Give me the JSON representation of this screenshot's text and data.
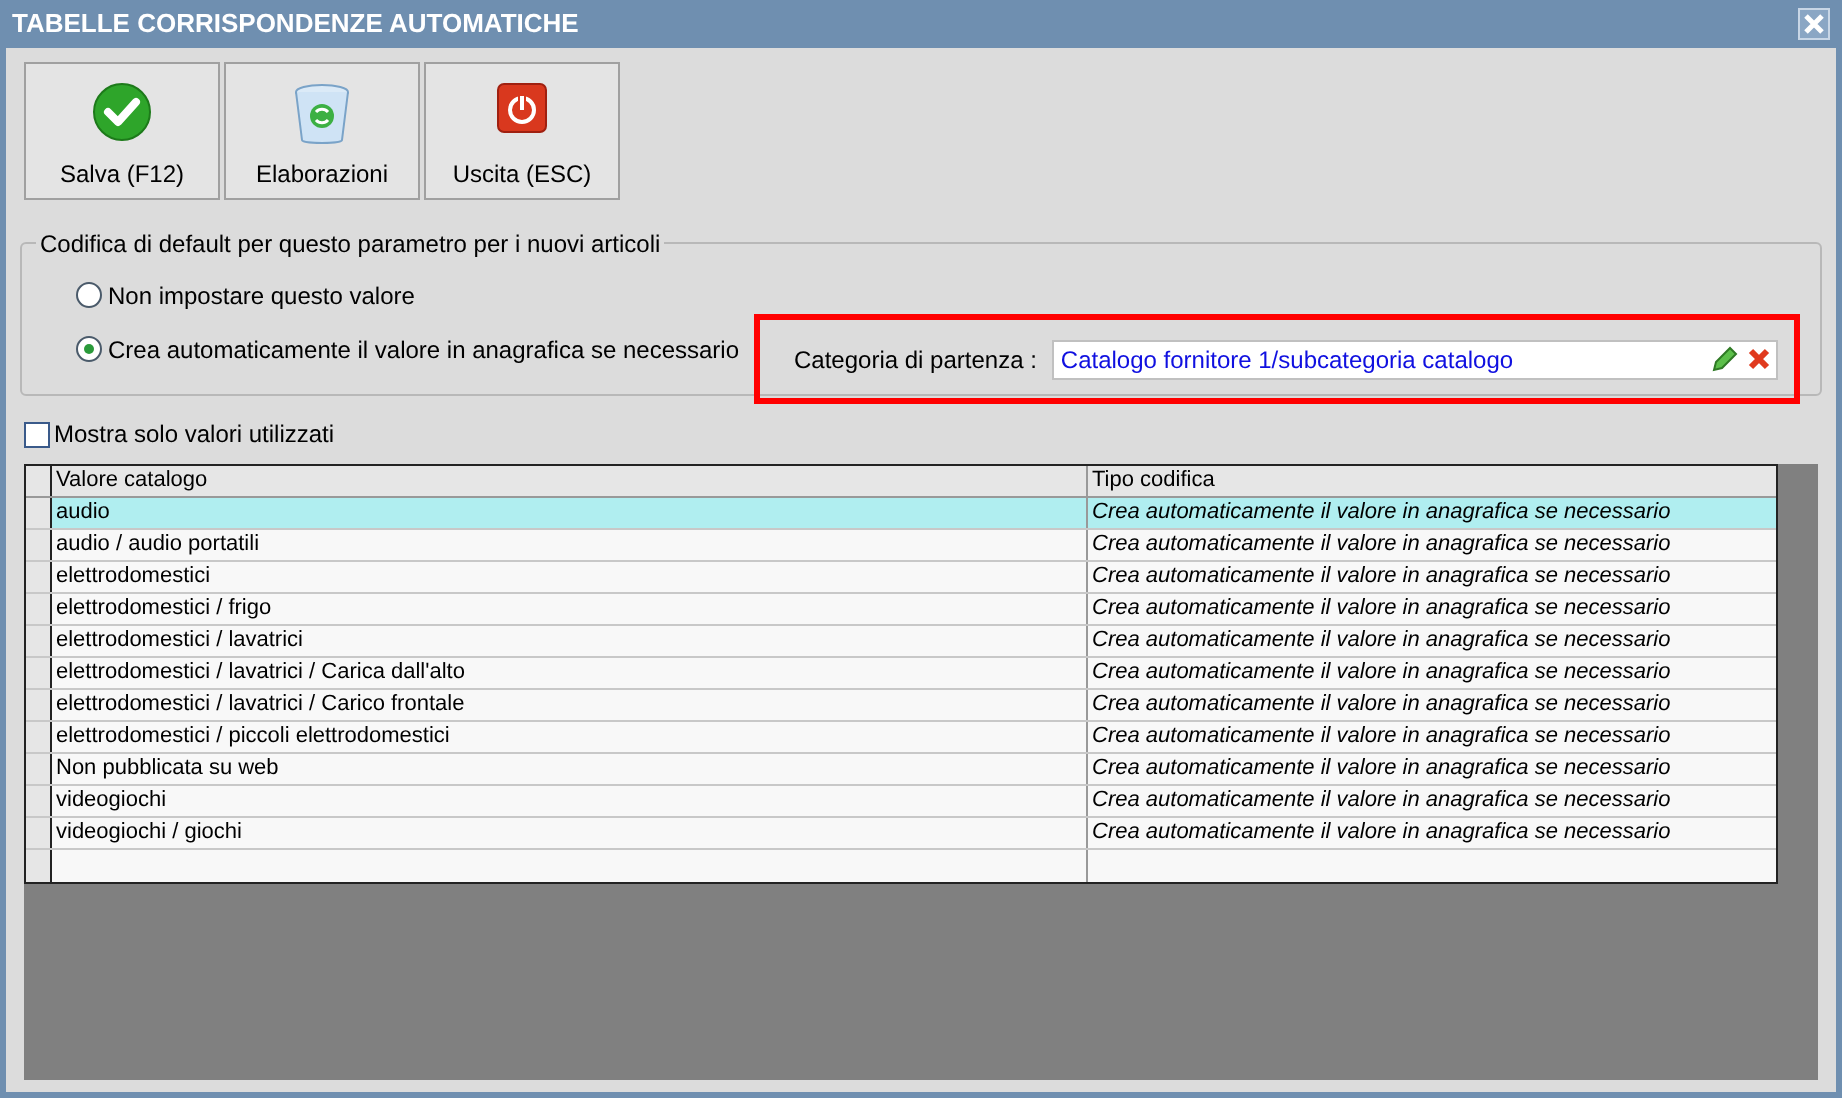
{
  "window": {
    "title": "TABELLE CORRISPONDENZE AUTOMATICHE"
  },
  "toolbar": [
    {
      "kind": "save",
      "label": "Salva (F12)"
    },
    {
      "kind": "process",
      "label": "Elaborazioni"
    },
    {
      "kind": "exit",
      "label": "Uscita (ESC)"
    }
  ],
  "default_group": {
    "title": "Codifica di default per questo parametro per i nuovi articoli",
    "options": [
      {
        "label": "Non impostare questo valore",
        "selected": false
      },
      {
        "label": "Crea automaticamente il valore in anagrafica se necessario",
        "selected": true
      }
    ],
    "category": {
      "label": "Categoria di partenza :",
      "value": "Catalogo fornitore 1/subcategoria catalogo",
      "highlighted": true
    }
  },
  "filter": {
    "label": "Mostra solo valori utilizzati",
    "checked": false
  },
  "table": {
    "columns": [
      "Valore catalogo",
      "Tipo codifica"
    ],
    "rows": [
      {
        "cells": [
          "audio",
          "Crea automaticamente il valore in anagrafica se necessario"
        ],
        "selected": true
      },
      {
        "cells": [
          "audio / audio portatili",
          "Crea automaticamente il valore in anagrafica se necessario"
        ],
        "selected": false
      },
      {
        "cells": [
          "elettrodomestici",
          "Crea automaticamente il valore in anagrafica se necessario"
        ],
        "selected": false
      },
      {
        "cells": [
          "elettrodomestici / frigo",
          "Crea automaticamente il valore in anagrafica se necessario"
        ],
        "selected": false
      },
      {
        "cells": [
          "elettrodomestici / lavatrici",
          "Crea automaticamente il valore in anagrafica se necessario"
        ],
        "selected": false
      },
      {
        "cells": [
          "elettrodomestici / lavatrici / Carica dall'alto",
          "Crea automaticamente il valore in anagrafica se necessario"
        ],
        "selected": false
      },
      {
        "cells": [
          "elettrodomestici / lavatrici / Carico frontale",
          "Crea automaticamente il valore in anagrafica se necessario"
        ],
        "selected": false
      },
      {
        "cells": [
          "elettrodomestici / piccoli elettrodomestici",
          "Crea automaticamente il valore in anagrafica se necessario"
        ],
        "selected": false
      },
      {
        "cells": [
          "Non pubblicata su web",
          "Crea automaticamente il valore in anagrafica se necessario"
        ],
        "selected": false
      },
      {
        "cells": [
          "videogiochi",
          "Crea automaticamente il valore in anagrafica se necessario"
        ],
        "selected": false
      },
      {
        "cells": [
          "videogiochi / giochi",
          "Crea automaticamente il valore in anagrafica se necessario"
        ],
        "selected": false
      }
    ]
  }
}
